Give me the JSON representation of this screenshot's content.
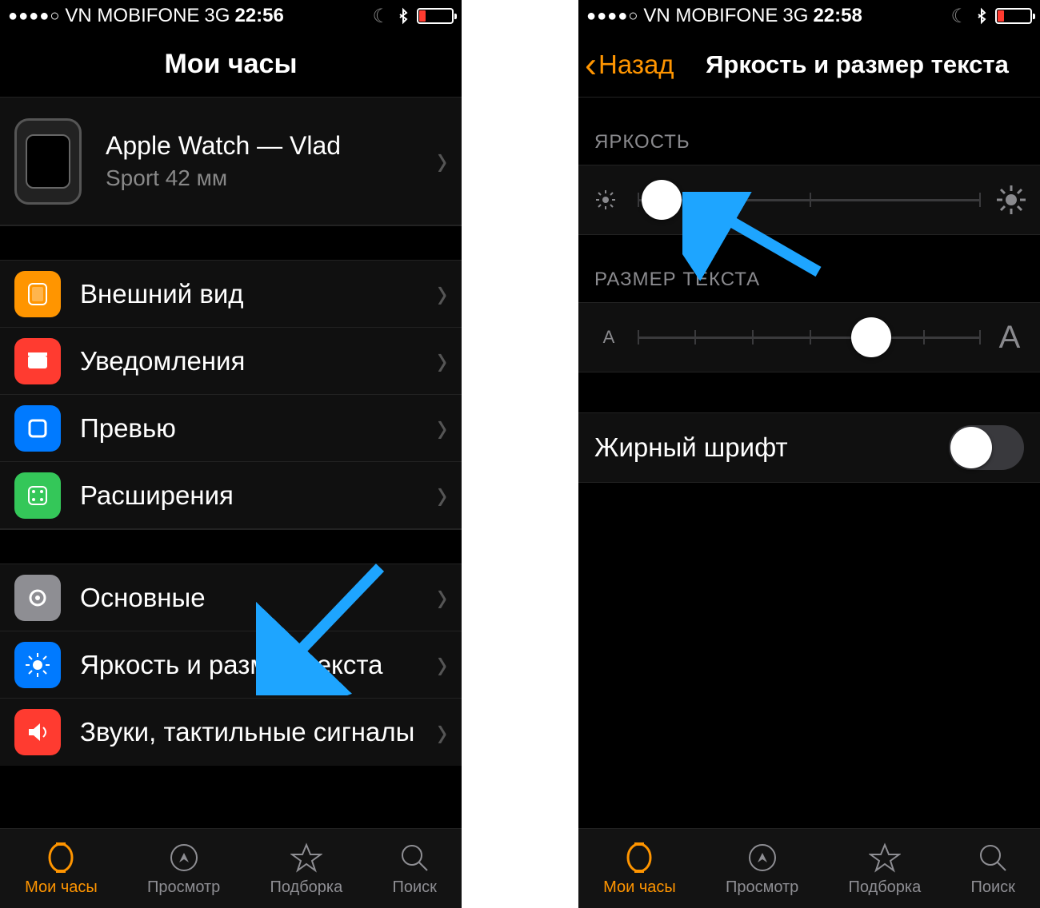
{
  "left": {
    "status": {
      "signal": "●●●●○",
      "carrier": "VN MOBIFONE",
      "network": "3G",
      "time": "22:56"
    },
    "title": "Мои часы",
    "watch": {
      "name": "Apple Watch — Vlad",
      "subtitle": "Sport 42 мм"
    },
    "rows1": [
      {
        "label": "Внешний вид",
        "color": "#ff9500",
        "icon": "appearance"
      },
      {
        "label": "Уведомления",
        "color": "#ff3b30",
        "icon": "notifications"
      },
      {
        "label": "Превью",
        "color": "#007aff",
        "icon": "preview"
      },
      {
        "label": "Расширения",
        "color": "#34c759",
        "icon": "extensions"
      }
    ],
    "rows2": [
      {
        "label": "Основные",
        "color": "#8e8e93",
        "icon": "gear"
      },
      {
        "label": "Яркость и размер текста",
        "color": "#007aff",
        "icon": "brightness"
      },
      {
        "label": "Звуки, тактильные сигналы",
        "color": "#ff3b30",
        "icon": "sound"
      }
    ],
    "tabs": [
      {
        "label": "Мои часы",
        "active": true
      },
      {
        "label": "Просмотр"
      },
      {
        "label": "Подборка"
      },
      {
        "label": "Поиск"
      }
    ]
  },
  "right": {
    "status": {
      "signal": "●●●●○",
      "carrier": "VN MOBIFONE",
      "network": "3G",
      "time": "22:58"
    },
    "back": "Назад",
    "title": "Яркость и размер текста",
    "brightness": {
      "header": "ЯРКОСТЬ",
      "value_percent": 7
    },
    "textsize": {
      "header": "РАЗМЕР ТЕКСТА",
      "value_percent": 68
    },
    "bold_font": {
      "label": "Жирный шрифт",
      "on": false
    },
    "tabs": [
      {
        "label": "Мои часы",
        "active": true
      },
      {
        "label": "Просмотр"
      },
      {
        "label": "Подборка"
      },
      {
        "label": "Поиск"
      }
    ]
  }
}
